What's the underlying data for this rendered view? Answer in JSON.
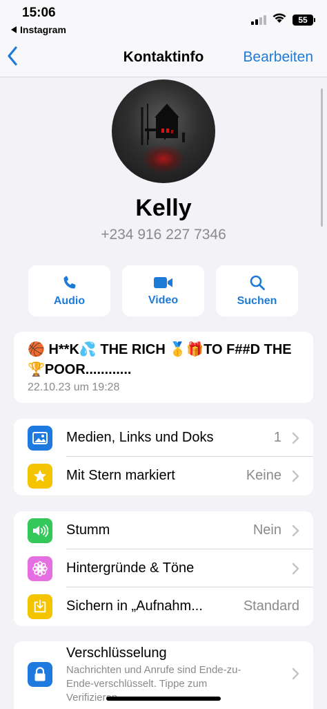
{
  "status_bar": {
    "time": "15:06",
    "back_app": "Instagram",
    "battery": "55"
  },
  "nav": {
    "title": "Kontaktinfo",
    "edit_label": "Bearbeiten"
  },
  "contact": {
    "name": "Kelly",
    "phone": "+234 916 227 7346"
  },
  "actions": [
    {
      "label": "Audio",
      "icon": "phone-icon"
    },
    {
      "label": "Video",
      "icon": "video-icon"
    },
    {
      "label": "Suchen",
      "icon": "search-icon"
    }
  ],
  "about": {
    "text": "🏀 H**K💦 THE RICH 🥇🎁TO F##D THE 🏆POOR............",
    "date": "22.10.23 um 19:28"
  },
  "group1": [
    {
      "label": "Medien, Links und Doks",
      "value": "1",
      "icon": "photo-icon",
      "color": "#1f7ae0"
    },
    {
      "label": "Mit Stern markiert",
      "value": "Keine",
      "icon": "star-icon",
      "color": "#f5c400"
    }
  ],
  "group2": [
    {
      "label": "Stumm",
      "value": "Nein",
      "icon": "speaker-icon",
      "color": "#34c759"
    },
    {
      "label": "Hintergründe & Töne",
      "value": "",
      "icon": "flower-icon",
      "color": "#e46fe0"
    },
    {
      "label": "Sichern in „Aufnahm...",
      "value": "Standard",
      "icon": "save-icon",
      "color": "#f5c400"
    }
  ],
  "encryption": {
    "title": "Verschlüsselung",
    "description": "Nachrichten und Anrufe sind Ende-zu-Ende-verschlüsselt. Tippe zum Verifizieren",
    "icon": "lock-icon",
    "color": "#1f7ae0"
  },
  "colors": {
    "accent": "#1d7ad6",
    "background": "#f2f2f7",
    "secondary_text": "#8a8a8e"
  }
}
